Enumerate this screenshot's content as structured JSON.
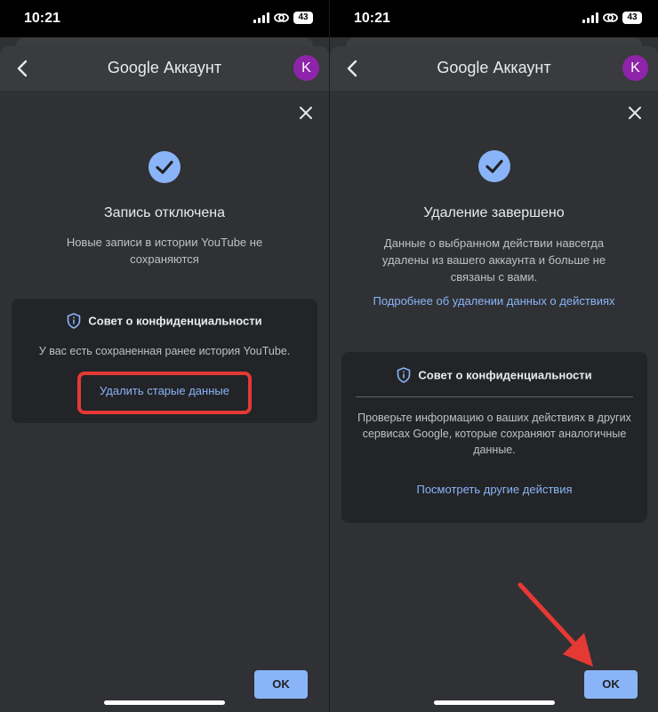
{
  "left": {
    "status": {
      "time": "10:21",
      "battery": "43"
    },
    "header": {
      "google": "Google",
      "account": "Аккаунт",
      "avatar": "K"
    },
    "title": "Запись отключена",
    "description": "Новые записи в истории YouTube не сохраняются",
    "tip": {
      "heading": "Совет о конфиденциальности",
      "text": "У вас есть сохраненная ранее история YouTube.",
      "action": "Удалить старые данные"
    },
    "ok_label": "OK"
  },
  "right": {
    "status": {
      "time": "10:21",
      "battery": "43"
    },
    "header": {
      "google": "Google",
      "account": "Аккаунт",
      "avatar": "K"
    },
    "title": "Удаление завершено",
    "description": "Данные о выбранном действии навсегда удалены из вашего аккаунта и больше не связаны с вами.",
    "more_link": "Подробнее об удалении данных о действиях",
    "tip": {
      "heading": "Совет о конфиденциальности",
      "text": "Проверьте информацию о ваших действиях в других сервисах Google, которые сохраняют аналогичные данные.",
      "action": "Посмотреть другие действия"
    },
    "ok_label": "OK"
  },
  "colors": {
    "background": "#303134",
    "accent": "#8ab4f8",
    "card": "#232427",
    "avatar": "#8e24aa",
    "highlight": "#e53935"
  },
  "icons": [
    "back-arrow-icon",
    "close-icon",
    "check-circle-icon",
    "shield-info-icon",
    "signal-icon",
    "link-icon",
    "battery-icon",
    "red-pointer-arrow-icon"
  ]
}
